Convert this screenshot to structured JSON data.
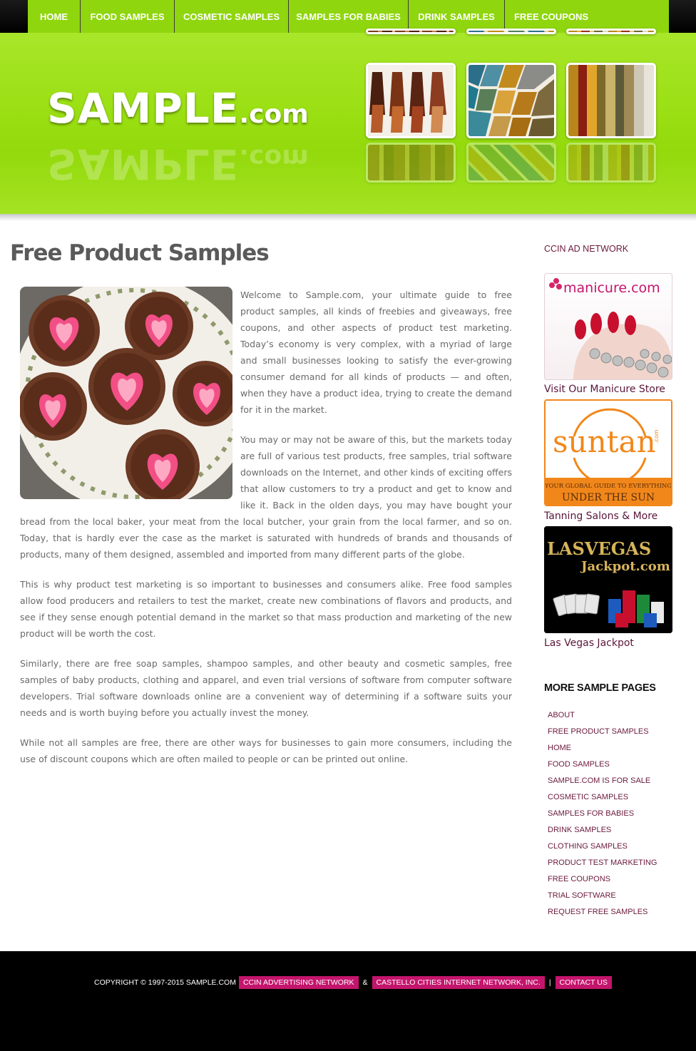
{
  "nav": {
    "items": [
      {
        "label": "HOME",
        "width": 74
      },
      {
        "label": "FOOD SAMPLES",
        "width": 132
      },
      {
        "label": "COSMETIC SAMPLES",
        "width": 160
      },
      {
        "label": "SAMPLES FOR BABIES",
        "width": 168
      },
      {
        "label": "DRINK SAMPLES",
        "width": 135
      },
      {
        "label": "FREE COUPONS",
        "width": 130
      }
    ]
  },
  "header": {
    "logo_main": "SAMPLE",
    "logo_suffix": ".com",
    "colors": {
      "accent": "#9adf12",
      "nav_bg": "#8fd60e"
    }
  },
  "main": {
    "title": "Free Product Samples",
    "paragraphs": [
      "Welcome to Sample.com, your ultimate guide to free product samples, all kinds of freebies and giveaways, free coupons, and other aspects of product test marketing. Today’s economy is very complex, with a myriad of large and small businesses looking to satisfy the ever-growing consumer demand for all kinds of products — and often, when they have a product idea, trying to create the demand for it in the market.",
      "You may or may not be aware of this, but the markets today are full of various test products, free samples, trial software downloads on the Internet, and other kinds of exciting offers that allow customers to try a product and get to know and like it. Back in the olden days, you may have bought your bread from the local baker, your meat from the local butcher, your grain from the local farmer, and so on. Today, that is hardly ever the case as the market is saturated with hundreds of brands and thousands of products, many of them designed, assembled and imported from many different parts of the globe.",
      "This is why product test marketing is so important to businesses and consumers alike. Free food samples allow food producers and retailers to test the market, create new combinations of flavors and products, and see if they sense enough potential demand in the market so that mass production and marketing of the new product will be worth the cost.",
      "Similarly, there are free soap samples, shampoo samples, and other beauty and cosmetic samples, free samples of baby products, clothing and apparel, and even trial versions of software from computer software developers. Trial software downloads online are a convenient way of determining if a software suits your needs and is worth buying before you actually invest the money.",
      "While not all samples are free, there are other ways for businesses to gain more consumers, including the use of discount coupons which are often mailed to people or can be printed out online."
    ]
  },
  "sidebar": {
    "ad_heading": "CCIN AD NETWORK",
    "ads": [
      {
        "brand": "manicure.com",
        "caption": "Visit Our Manicure Store"
      },
      {
        "brand": "suntan",
        "brand_suffix": ".com",
        "tagline": "YOUR GLOBAL GUIDE TO EVERYTHING",
        "tagline2": "UNDER THE SUN",
        "caption": "Tanning Salons & More"
      },
      {
        "brand": "LASVEGAS",
        "brand2": "Jackpot.com",
        "caption": "Las Vegas Jackpot"
      }
    ],
    "more_heading": "MORE SAMPLE PAGES",
    "more_links": [
      "ABOUT",
      "FREE PRODUCT SAMPLES",
      "HOME",
      "FOOD SAMPLES",
      "SAMPLE.COM IS FOR SALE",
      "COSMETIC SAMPLES",
      "SAMPLES FOR BABIES",
      "DRINK SAMPLES",
      "CLOTHING SAMPLES",
      "PRODUCT TEST MARKETING",
      "FREE COUPONS",
      "TRIAL SOFTWARE",
      "REQUEST FREE SAMPLES"
    ]
  },
  "footer": {
    "copyright": "COPYRIGHT © 1997-2015 SAMPLE.COM",
    "link1": "CCIN ADVERTISING NETWORK",
    "amp": "&",
    "link2": "CASTELLO CITIES INTERNET NETWORK, INC.",
    "pipe": "|",
    "link3": "CONTACT US"
  }
}
